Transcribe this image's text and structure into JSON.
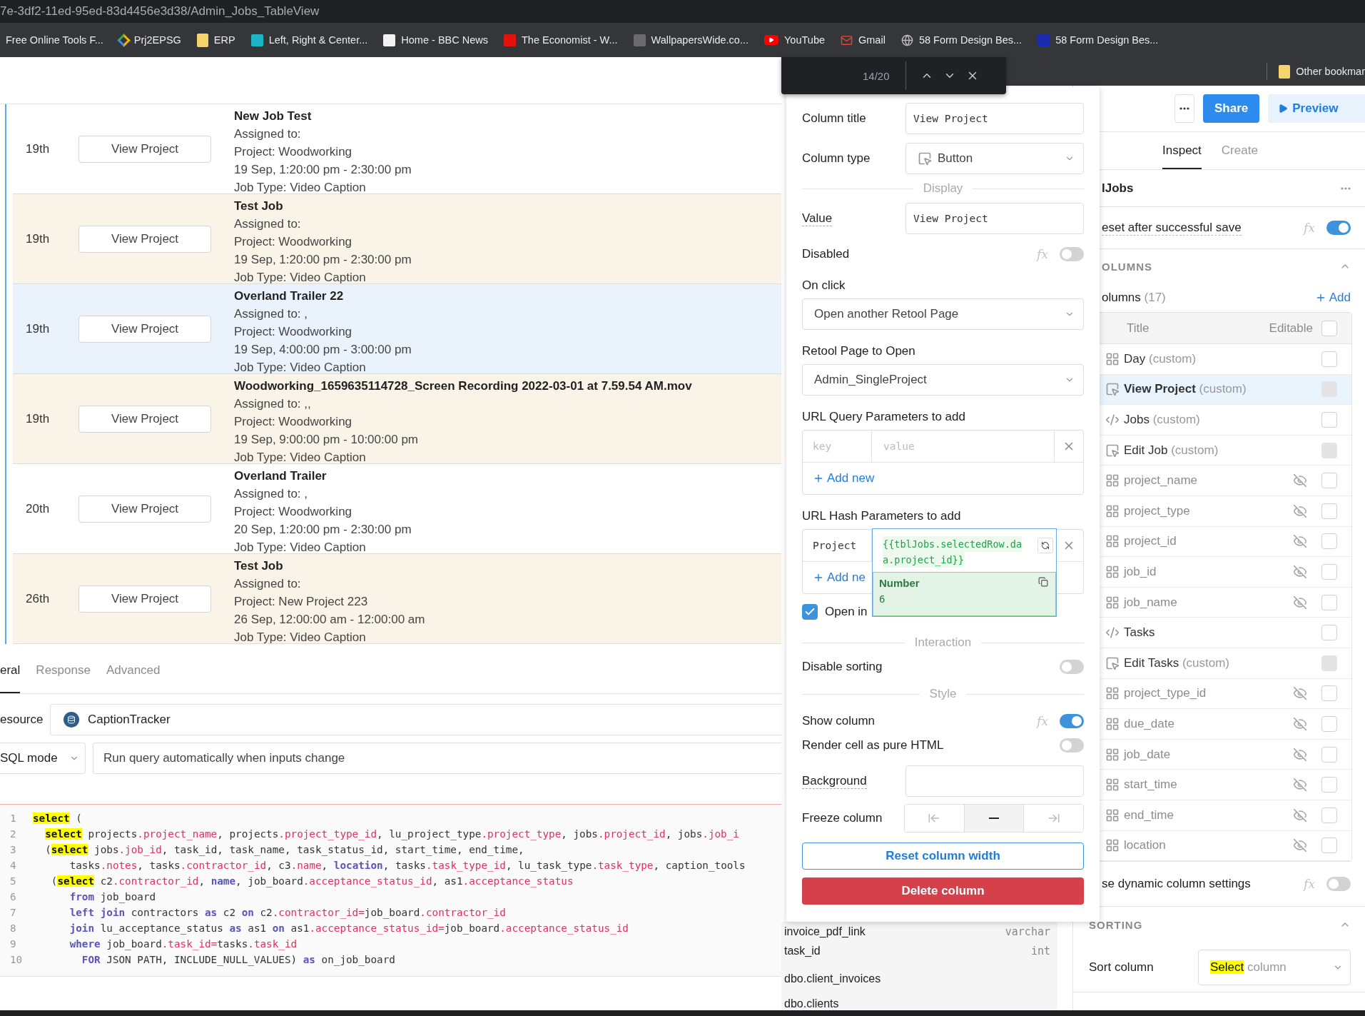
{
  "address_bar": {
    "url": "7e-3df2-11ed-95ed-83d4456e3d38/Admin_Jobs_TableView"
  },
  "bookmarks": [
    {
      "label": "Free Online Tools F...",
      "kind": "none"
    },
    {
      "label": "Prj2EPSG",
      "kind": "diamond",
      "color": "#f4b400"
    },
    {
      "label": "ERP",
      "kind": "folder",
      "color": "#f6d36b"
    },
    {
      "label": "Left, Right & Center...",
      "kind": "square",
      "color": "#1fb5c9"
    },
    {
      "label": "Home - BBC News",
      "kind": "square",
      "color": "#f2f2f2"
    },
    {
      "label": "The Economist - W...",
      "kind": "square",
      "color": "#e3120b"
    },
    {
      "label": "WallpapersWide.co...",
      "kind": "square",
      "color": "#6b6b6b"
    },
    {
      "label": "YouTube",
      "kind": "play",
      "color": "#ff0000"
    },
    {
      "label": "Gmail",
      "kind": "envelope",
      "color": "#ea4335"
    },
    {
      "label": "58 Form Design Bes...",
      "kind": "globe",
      "color": "#bdbdbd"
    },
    {
      "label": "58 Form Design Bes...",
      "kind": "square",
      "color": "#1a2bb0"
    }
  ],
  "other_bookmarks": {
    "label": "Other bookmar",
    "kind": "folder",
    "color": "#f6d36b"
  },
  "find_bar": {
    "count": "14/20"
  },
  "jobs_table": {
    "rows": [
      {
        "day": "19th",
        "button": "View Project",
        "title": "New Job Test",
        "lines": [
          "Assigned to:",
          "Project: Woodworking",
          "19 Sep, 1:20:00 pm - 2:30:00 pm",
          "Job Type: Video Caption"
        ],
        "tinted": false,
        "selected": false
      },
      {
        "day": "19th",
        "button": "View Project",
        "title": "Test Job",
        "lines": [
          "Assigned to:",
          "Project: Woodworking",
          "19 Sep, 1:20:00 pm - 2:30:00 pm",
          "Job Type: Video Caption"
        ],
        "tinted": true,
        "selected": false
      },
      {
        "day": "19th",
        "button": "View Project",
        "title": "Overland Trailer 22",
        "lines": [
          "Assigned to: ,",
          "Project: Woodworking",
          "19 Sep, 4:00:00 pm - 3:00:00 pm",
          "Job Type: Video Caption"
        ],
        "tinted": false,
        "selected": true
      },
      {
        "day": "19th",
        "button": "View Project",
        "title": "Woodworking_1659635114728_Screen Recording 2022-03-01 at 7.59.54 AM.mov",
        "lines": [
          "Assigned to: ,,",
          "Project: Woodworking",
          "19 Sep, 9:00:00 pm - 10:00:00 pm",
          "Job Type: Video Caption"
        ],
        "tinted": true,
        "selected": false
      },
      {
        "day": "20th",
        "button": "View Project",
        "title": "Overland Trailer",
        "lines": [
          "Assigned to: ,",
          "Project: Woodworking",
          "20 Sep, 1:20:00 pm - 2:30:00 pm",
          "Job Type: Video Caption"
        ],
        "tinted": false,
        "selected": false
      },
      {
        "day": "26th",
        "button": "View Project",
        "title": "Test Job",
        "lines": [
          "Assigned to:",
          "Project: New Project 223",
          "26 Sep, 12:00:00 am - 12:00:00 am",
          "Job Type: Video Caption"
        ],
        "tinted": true,
        "selected": false
      }
    ]
  },
  "query": {
    "tabs": [
      {
        "label": "eral",
        "selected": true
      },
      {
        "label": "Response",
        "selected": false
      },
      {
        "label": "Advanced",
        "selected": false
      }
    ],
    "resource_label": "esource",
    "resource": "CaptionTracker",
    "mode": "SQL mode",
    "trigger": "Run query automatically when inputs change",
    "code": [
      {
        "number": "1",
        "kind": "top",
        "tokens": [
          {
            "text": "select",
            "kind": "match"
          },
          {
            "text": " (",
            "kind": "plain"
          }
        ]
      },
      {
        "number": "2",
        "kind": "child",
        "tokens": [
          {
            "text": "select",
            "kind": "match"
          },
          {
            "text": " projects",
            "kind": "plain"
          },
          {
            "text": ".project_name",
            "kind": "prop"
          },
          {
            "text": ", projects",
            "kind": "plain"
          },
          {
            "text": ".project_type_id",
            "kind": "prop"
          },
          {
            "text": ", lu_project_type",
            "kind": "plain"
          },
          {
            "text": ".project_type",
            "kind": "prop"
          },
          {
            "text": ", jobs",
            "kind": "plain"
          },
          {
            "text": ".project_id",
            "kind": "prop"
          },
          {
            "text": ", jobs",
            "kind": "plain"
          },
          {
            "text": ".job_i",
            "kind": "prop"
          }
        ]
      },
      {
        "number": "3",
        "kind": "child",
        "tokens": [
          {
            "text": "(",
            "kind": "plain"
          },
          {
            "text": "select",
            "kind": "match"
          },
          {
            "text": " jobs",
            "kind": "plain"
          },
          {
            "text": ".job_id",
            "kind": "prop"
          },
          {
            "text": ", task_id, task_name, task_status_id, start_time, end_time,",
            "kind": "plain"
          }
        ]
      },
      {
        "number": "4",
        "kind": "nested",
        "tokens": [
          {
            "text": "tasks",
            "kind": "plain"
          },
          {
            "text": ".notes",
            "kind": "prop"
          },
          {
            "text": ", tasks",
            "kind": "plain"
          },
          {
            "text": ".contractor_id",
            "kind": "prop"
          },
          {
            "text": ", c3",
            "kind": "plain"
          },
          {
            "text": ".name",
            "kind": "prop"
          },
          {
            "text": ", ",
            "kind": "plain"
          },
          {
            "text": "location",
            "kind": "keyword"
          },
          {
            "text": ", tasks",
            "kind": "plain"
          },
          {
            "text": ".task_type_id",
            "kind": "prop"
          },
          {
            "text": ", lu_task_type",
            "kind": "plain"
          },
          {
            "text": ".task_type",
            "kind": "prop"
          },
          {
            "text": ", caption_tools",
            "kind": "plain"
          }
        ]
      },
      {
        "number": "5",
        "kind": "sub",
        "tokens": [
          {
            "text": "(",
            "kind": "plain"
          },
          {
            "text": "select",
            "kind": "match"
          },
          {
            "text": " c2",
            "kind": "plain"
          },
          {
            "text": ".contractor_id",
            "kind": "prop"
          },
          {
            "text": ", ",
            "kind": "plain"
          },
          {
            "text": "name",
            "kind": "keyword"
          },
          {
            "text": ", job_board",
            "kind": "plain"
          },
          {
            "text": ".acceptance_status_id",
            "kind": "prop"
          },
          {
            "text": ", as1",
            "kind": "plain"
          },
          {
            "text": ".acceptance_status",
            "kind": "prop"
          }
        ]
      },
      {
        "number": "6",
        "kind": "nested",
        "tokens": [
          {
            "text": "from",
            "kind": "keyword"
          },
          {
            "text": " job_board",
            "kind": "plain"
          }
        ]
      },
      {
        "number": "7",
        "kind": "nested",
        "tokens": [
          {
            "text": "left join",
            "kind": "keyword"
          },
          {
            "text": " contractors ",
            "kind": "plain"
          },
          {
            "text": "as",
            "kind": "keyword"
          },
          {
            "text": " c2 ",
            "kind": "plain"
          },
          {
            "text": "on",
            "kind": "keyword"
          },
          {
            "text": " c2",
            "kind": "plain"
          },
          {
            "text": ".contractor_id=",
            "kind": "prop"
          },
          {
            "text": "job_board",
            "kind": "plain"
          },
          {
            "text": ".contractor_id",
            "kind": "prop"
          }
        ]
      },
      {
        "number": "8",
        "kind": "nested",
        "tokens": [
          {
            "text": "join",
            "kind": "keyword"
          },
          {
            "text": " lu_acceptance_status ",
            "kind": "plain"
          },
          {
            "text": "as",
            "kind": "keyword"
          },
          {
            "text": " as1 ",
            "kind": "plain"
          },
          {
            "text": "on",
            "kind": "keyword"
          },
          {
            "text": " as1",
            "kind": "plain"
          },
          {
            "text": ".acceptance_status_id=",
            "kind": "prop"
          },
          {
            "text": "job_board",
            "kind": "plain"
          },
          {
            "text": ".acceptance_status_id",
            "kind": "prop"
          }
        ]
      },
      {
        "number": "9",
        "kind": "nested",
        "tokens": [
          {
            "text": "where",
            "kind": "keyword"
          },
          {
            "text": " job_board",
            "kind": "plain"
          },
          {
            "text": ".task_id=",
            "kind": "prop"
          },
          {
            "text": "tasks",
            "kind": "plain"
          },
          {
            "text": ".task_id",
            "kind": "prop"
          }
        ]
      },
      {
        "number": "10",
        "kind": "deepest",
        "tokens": [
          {
            "text": "FOR",
            "kind": "keyword"
          },
          {
            "text": " JSON PATH, INCLUDE_NULL_VALUES) ",
            "kind": "plain"
          },
          {
            "text": "as",
            "kind": "keyword"
          },
          {
            "text": " on_job_board",
            "kind": "plain"
          }
        ]
      }
    ]
  },
  "schema": {
    "fields": [
      {
        "name": "invoice_pdf_link",
        "type": "varchar"
      },
      {
        "name": "task_id",
        "type": "int"
      }
    ],
    "tables": [
      "dbo.client_invoices",
      "dbo.clients"
    ]
  },
  "column_editor": {
    "column_title": {
      "label": "Column title",
      "value": "View Project"
    },
    "column_type": {
      "label": "Column type",
      "value": "Button"
    },
    "display_heading": "Display",
    "value": {
      "label": "Value",
      "value": "View Project"
    },
    "disabled": {
      "label": "Disabled",
      "fx": "fx",
      "on": false
    },
    "on_click": {
      "label": "On click",
      "value": "Open another Retool Page"
    },
    "page_to_open": {
      "label": "Retool Page to Open",
      "value": "Admin_SingleProject"
    },
    "query_params": {
      "label": "URL Query Parameters to add",
      "key_placeholder": "key",
      "value_placeholder": "value",
      "add": "Add new"
    },
    "hash_params": {
      "label": "URL Hash Parameters to add",
      "key": "Project",
      "value_lines": [
        "{{tblJobs.selectedRow.da",
        "a.project_id}}"
      ],
      "result_type": "Number",
      "result": "6",
      "add": "Add ne"
    },
    "open_in": {
      "label": "Open in",
      "checked": true
    },
    "interaction_heading": "Interaction",
    "disable_sorting": {
      "label": "Disable sorting",
      "on": false
    },
    "style_heading": "Style",
    "show_column": {
      "label": "Show column",
      "fx": "fx",
      "on": true
    },
    "render_html": {
      "label": "Render cell as pure HTML",
      "on": false
    },
    "background": {
      "label": "Background"
    },
    "freeze": {
      "label": "Freeze column",
      "options": [
        {
          "kind": "left",
          "selected": false
        },
        {
          "kind": "none",
          "selected": true
        },
        {
          "kind": "right",
          "selected": false
        }
      ]
    },
    "reset_button": "Reset column width",
    "delete_button": "Delete column"
  },
  "inspector": {
    "toolbar": {
      "share": "Share",
      "preview": "Preview"
    },
    "tabs": [
      {
        "label": "Inspect",
        "selected": true
      },
      {
        "label": "Create",
        "selected": false
      }
    ],
    "component_name": "lJobs",
    "reset_after_save": {
      "label": "eset after successful save",
      "fx": "fx",
      "on": true
    },
    "columns": {
      "heading": "OLUMNS",
      "expanded": true,
      "count_label": "olumns",
      "count": "(17)",
      "add": "Add",
      "header_title": "Title",
      "header_editable": "Editable",
      "header_checked": false,
      "items": [
        {
          "name": "Day",
          "custom": "(custom)",
          "kind": "grid",
          "hidden": false,
          "selected": false,
          "checked": false,
          "disabled": false
        },
        {
          "name": "View Project",
          "custom": "(custom)",
          "kind": "button",
          "hidden": false,
          "selected": true,
          "checked": false,
          "disabled": true
        },
        {
          "name": "Jobs",
          "custom": "(custom)",
          "kind": "code",
          "hidden": false,
          "selected": false,
          "checked": false,
          "disabled": false
        },
        {
          "name": "Edit Job",
          "custom": "(custom)",
          "kind": "button",
          "hidden": false,
          "selected": false,
          "checked": false,
          "disabled": true
        },
        {
          "name": "project_name",
          "kind": "grid",
          "hidden": true,
          "selected": false,
          "checked": false,
          "disabled": false
        },
        {
          "name": "project_type",
          "kind": "grid",
          "hidden": true,
          "selected": false,
          "checked": false,
          "disabled": false
        },
        {
          "name": "project_id",
          "kind": "grid",
          "hidden": true,
          "selected": false,
          "checked": false,
          "disabled": false
        },
        {
          "name": "job_id",
          "kind": "grid",
          "hidden": true,
          "selected": false,
          "checked": false,
          "disabled": false
        },
        {
          "name": "job_name",
          "kind": "grid",
          "hidden": true,
          "selected": false,
          "checked": false,
          "disabled": false
        },
        {
          "name": "Tasks",
          "kind": "code",
          "hidden": false,
          "selected": false,
          "checked": false,
          "disabled": false
        },
        {
          "name": "Edit Tasks",
          "custom": "(custom)",
          "kind": "button",
          "hidden": false,
          "selected": false,
          "checked": false,
          "disabled": true
        },
        {
          "name": "project_type_id",
          "kind": "grid",
          "hidden": true,
          "selected": false,
          "checked": false,
          "disabled": false
        },
        {
          "name": "due_date",
          "kind": "grid",
          "hidden": true,
          "selected": false,
          "checked": false,
          "disabled": false
        },
        {
          "name": "job_date",
          "kind": "grid",
          "hidden": true,
          "selected": false,
          "checked": false,
          "disabled": false
        },
        {
          "name": "start_time",
          "kind": "grid",
          "hidden": true,
          "selected": false,
          "checked": false,
          "disabled": false
        },
        {
          "name": "end_time",
          "kind": "grid",
          "hidden": true,
          "selected": false,
          "checked": false,
          "disabled": false
        },
        {
          "name": "location",
          "kind": "grid",
          "hidden": true,
          "selected": false,
          "checked": false,
          "disabled": false
        }
      ]
    },
    "dynamic_settings": {
      "label": "se dynamic column settings",
      "fx": "fx",
      "on": false
    },
    "sorting": {
      "heading": "SORTING",
      "expanded": true,
      "sort_label": "Sort column",
      "placeholder_parts": [
        {
          "text": "Select",
          "match": true
        },
        {
          "text": " column",
          "match": false
        }
      ]
    }
  }
}
